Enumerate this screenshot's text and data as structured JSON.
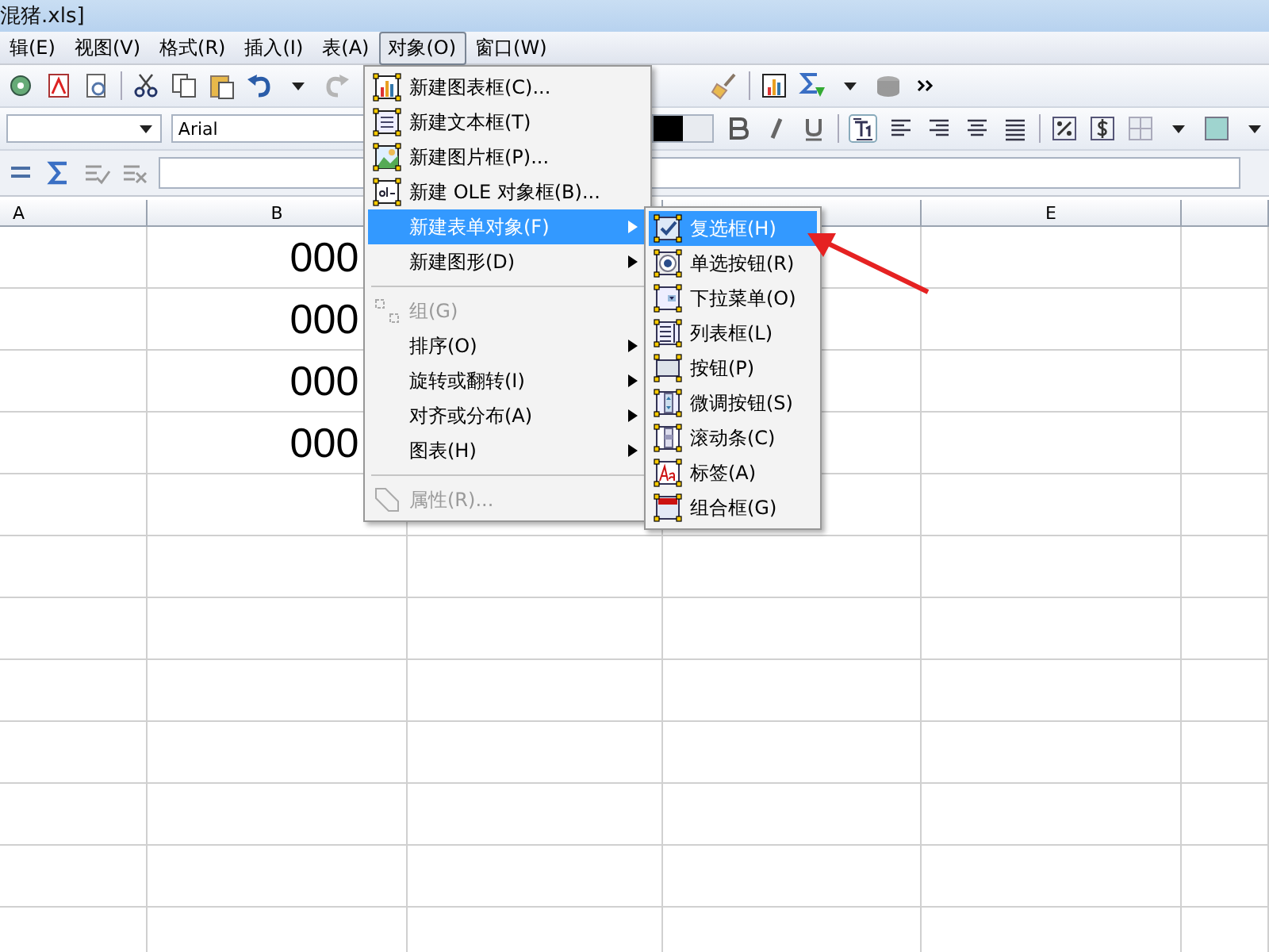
{
  "window": {
    "title": "混猪.xls]"
  },
  "menubar": [
    {
      "label": "辑(E)",
      "selected": false
    },
    {
      "label": "视图(V)",
      "selected": false
    },
    {
      "label": "格式(R)",
      "selected": false
    },
    {
      "label": "插入(I)",
      "selected": false
    },
    {
      "label": "表(A)",
      "selected": false
    },
    {
      "label": "对象(O)",
      "selected": true
    },
    {
      "label": "窗口(W)",
      "selected": false
    }
  ],
  "format_toolbar": {
    "font_name": "Arial"
  },
  "table": {
    "columns": [
      "A",
      "B",
      "E"
    ],
    "column_b_values": [
      "000",
      "000",
      "000",
      "000"
    ]
  },
  "object_menu": [
    {
      "kind": "item",
      "label": "新建图表框(C)...",
      "disabled": false,
      "selected": false,
      "submenu": false
    },
    {
      "kind": "item",
      "label": "新建文本框(T)",
      "disabled": false,
      "selected": false,
      "submenu": false
    },
    {
      "kind": "item",
      "label": "新建图片框(P)...",
      "disabled": false,
      "selected": false,
      "submenu": false
    },
    {
      "kind": "item",
      "label": "新建 OLE 对象框(B)...",
      "disabled": false,
      "selected": false,
      "submenu": false
    },
    {
      "kind": "item",
      "label": "新建表单对象(F)",
      "disabled": false,
      "selected": true,
      "submenu": true
    },
    {
      "kind": "item",
      "label": "新建图形(D)",
      "disabled": false,
      "selected": false,
      "submenu": true
    },
    {
      "kind": "separator"
    },
    {
      "kind": "item",
      "label": "组(G)",
      "disabled": true,
      "selected": false,
      "submenu": false
    },
    {
      "kind": "item",
      "label": "排序(O)",
      "disabled": false,
      "selected": false,
      "submenu": true
    },
    {
      "kind": "item",
      "label": "旋转或翻转(I)",
      "disabled": false,
      "selected": false,
      "submenu": true
    },
    {
      "kind": "item",
      "label": "对齐或分布(A)",
      "disabled": false,
      "selected": false,
      "submenu": true
    },
    {
      "kind": "item",
      "label": "图表(H)",
      "disabled": false,
      "selected": false,
      "submenu": true
    },
    {
      "kind": "separator"
    },
    {
      "kind": "item",
      "label": "属性(R)...",
      "disabled": true,
      "selected": false,
      "submenu": false
    }
  ],
  "form_object_submenu": [
    {
      "label": "复选框(H)",
      "selected": true
    },
    {
      "label": "单选按钮(R)",
      "selected": false
    },
    {
      "label": "下拉菜单(O)",
      "selected": false
    },
    {
      "label": "列表框(L)",
      "selected": false
    },
    {
      "label": "按钮(P)",
      "selected": false
    },
    {
      "label": "微调按钮(S)",
      "selected": false
    },
    {
      "label": "滚动条(C)",
      "selected": false
    },
    {
      "label": "标签(A)",
      "selected": false
    },
    {
      "label": "组合框(G)",
      "selected": false
    }
  ]
}
